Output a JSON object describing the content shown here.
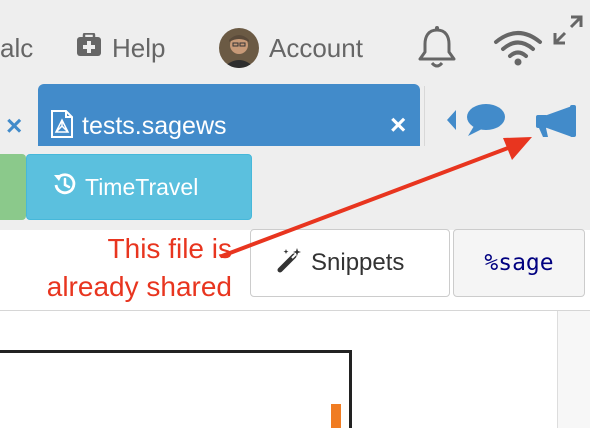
{
  "topbar": {
    "calc_label": "alc",
    "help_label": "Help",
    "account_label": "Account",
    "icons": [
      "medkit-icon",
      "avatar",
      "bell-icon",
      "wifi-icon",
      "expand-icon"
    ]
  },
  "tabs": {
    "active_title": "tests.sagews",
    "close_glyph": "×"
  },
  "toolbar": {
    "timetravel_label": "TimeTravel",
    "snippets_label": "Snippets",
    "mode_label": "%sage"
  },
  "annotation": {
    "line1": "This file is",
    "line2": "already shared"
  },
  "colors": {
    "accent": "#428bca",
    "timetravel": "#5bc0de",
    "annotation": "#e8351f",
    "mode_text": "#000080"
  }
}
